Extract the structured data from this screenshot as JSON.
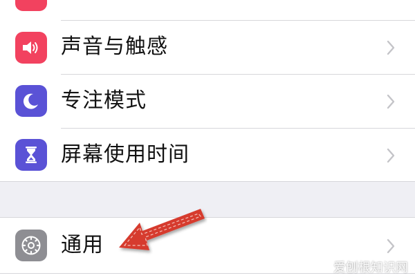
{
  "settings_list": {
    "items": [
      {
        "label": "声音与触感",
        "icon": "speaker-icon",
        "icon_color": "#f2425f"
      },
      {
        "label": "专注模式",
        "icon": "moon-icon",
        "icon_color": "#5a52d6"
      },
      {
        "label": "屏幕使用时间",
        "icon": "hourglass-icon",
        "icon_color": "#5a52d6"
      },
      {
        "label": "通用",
        "icon": "gear-icon",
        "icon_color": "#8e8e93"
      }
    ]
  },
  "annotation": {
    "arrow_color": "#d63b2e"
  },
  "watermark": "爱刨根知识网"
}
